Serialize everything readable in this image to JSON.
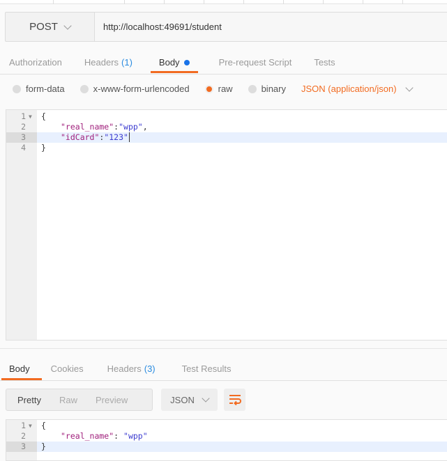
{
  "request": {
    "method": "POST",
    "url": "http://localhost:49691/student"
  },
  "request_tabs": [
    {
      "label": "Authorization"
    },
    {
      "label": "Headers",
      "count": "(1)"
    },
    {
      "label": "Body",
      "active": true
    },
    {
      "label": "Pre-request Script"
    },
    {
      "label": "Tests"
    }
  ],
  "body_modes": [
    {
      "label": "form-data",
      "selected": false
    },
    {
      "label": "x-www-form-urlencoded",
      "selected": false
    },
    {
      "label": "raw",
      "selected": true
    },
    {
      "label": "binary",
      "selected": false
    }
  ],
  "content_type": "JSON (application/json)",
  "request_body": {
    "lines": [
      "1",
      "2",
      "3",
      "4"
    ],
    "l1": "{",
    "l2k": "\"real_name\"",
    "l2s": "\"wpp\"",
    "l3k": "\"idCard\"",
    "l3s": "\"123\"",
    "l4": "}",
    "colon": ":",
    "comma": ","
  },
  "response_tabs": [
    {
      "label": "Body",
      "active": true
    },
    {
      "label": "Cookies"
    },
    {
      "label": "Headers",
      "count": "(3)"
    },
    {
      "label": "Test Results"
    }
  ],
  "view_modes": [
    "Pretty",
    "Raw",
    "Preview"
  ],
  "format": "JSON",
  "response_body": {
    "lines": [
      "1",
      "2",
      "3"
    ],
    "l1": "{",
    "l2k": "\"real_name\"",
    "l2s": "\"wpp\"",
    "l3": "}",
    "colon": ": "
  },
  "colors": {
    "accent": "#f26b21",
    "count": "#2a8be0"
  },
  "icons": [
    "chevron-down-icon",
    "wrap-lines-icon",
    "fold-arrow-icon"
  ]
}
